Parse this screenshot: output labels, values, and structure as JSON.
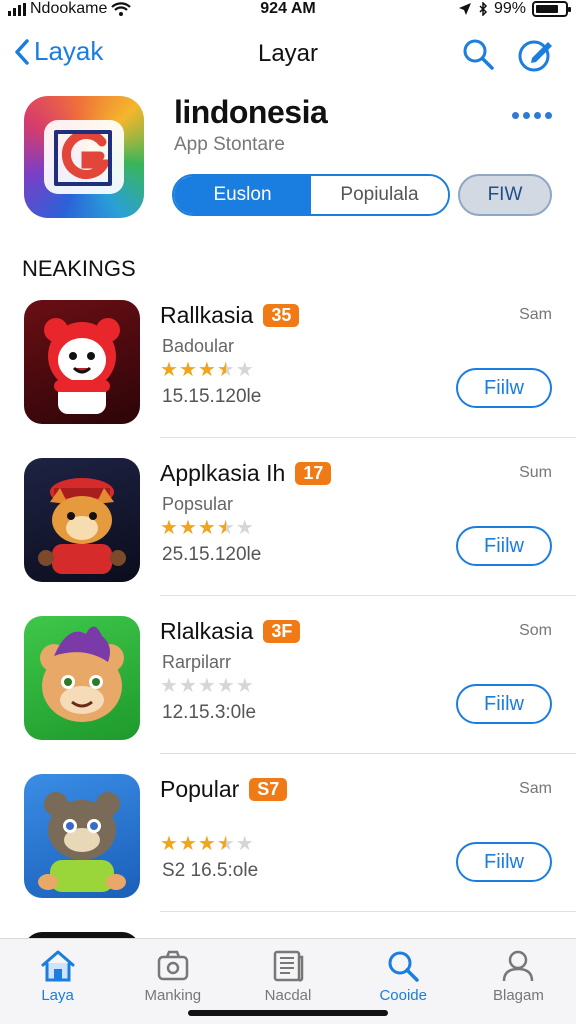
{
  "status_bar": {
    "carrier": "Ndookame",
    "time": "924 AM",
    "battery": "99%"
  },
  "nav": {
    "back_label": "Layak",
    "title": "Layar"
  },
  "header": {
    "app_name": "lindonesia",
    "app_subtitle": "App Stontare",
    "segments": [
      "Euslon",
      "Popiulala"
    ],
    "filter_label": "FIW"
  },
  "section_title": "NEAKINGS",
  "rankings": [
    {
      "name": "Rallkasia",
      "badge": "35",
      "subtitle": "Badoular",
      "rating": 3.5,
      "date": "15.15.120le",
      "size": "Sam",
      "button": "Fiilw"
    },
    {
      "name": "Applkasia Ih",
      "badge": "17",
      "subtitle": "Popsular",
      "rating": 3.5,
      "date": "25.15.120le",
      "size": "Sum",
      "button": "Fiilw"
    },
    {
      "name": "Rlalkasia",
      "badge": "3F",
      "subtitle": "Rarpilarr",
      "rating": 0,
      "date": "12.15.3:0le",
      "size": "Som",
      "button": "Fiilw"
    },
    {
      "name": "Popular",
      "badge": "S7",
      "subtitle": "",
      "rating": 3.5,
      "date": "S2 16.5:ole",
      "size": "Sam",
      "button": "Fiilw"
    }
  ],
  "tabs": [
    {
      "label": "Laya",
      "icon": "home-icon",
      "active": true
    },
    {
      "label": "Manking",
      "icon": "camera-bag-icon",
      "active": false
    },
    {
      "label": "Nacdal",
      "icon": "news-icon",
      "active": false
    },
    {
      "label": "Cooide",
      "icon": "search-icon",
      "active": false
    },
    {
      "label": "Blagam",
      "icon": "person-icon",
      "active": false
    }
  ],
  "colors": {
    "accent": "#1a7de0",
    "badge": "#f07a16",
    "star": "#f2a51c"
  }
}
